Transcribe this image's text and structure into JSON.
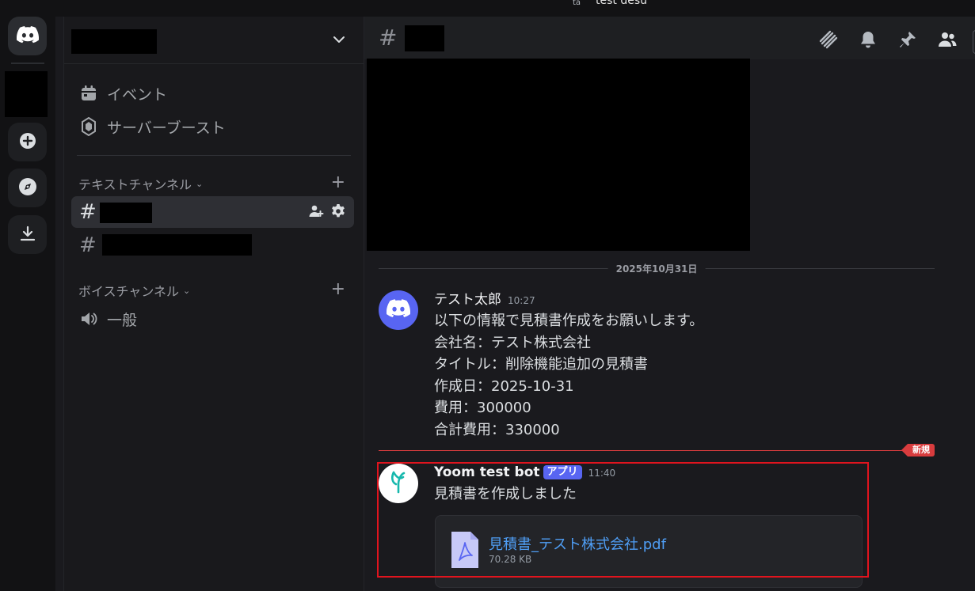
{
  "window": {
    "title": "test desu",
    "icon": "app-icon"
  },
  "rail": {
    "items": [
      {
        "name": "discord-home",
        "icon": "discord-logo-icon"
      },
      {
        "name": "redacted-server",
        "icon": ""
      },
      {
        "name": "add-server",
        "icon": "plus-circle-icon"
      },
      {
        "name": "explore-servers",
        "icon": "compass-icon"
      },
      {
        "name": "download-apps",
        "icon": "download-icon"
      }
    ]
  },
  "sidebar": {
    "server_name": "",
    "nav": [
      {
        "label": "イベント",
        "icon": "calendar-icon"
      },
      {
        "label": "サーバーブースト",
        "icon": "boost-gem-icon"
      }
    ],
    "text_category": "テキストチャンネル",
    "voice_category": "ボイスチャンネル",
    "text_channels": [
      {
        "hash": "#",
        "active": true
      },
      {
        "hash": "#",
        "active": false
      }
    ],
    "voice_channels": [
      {
        "label": "一般",
        "icon": "speaker-icon"
      }
    ]
  },
  "header": {
    "hash": "#",
    "icons": [
      "threads-icon",
      "bell-icon",
      "pin-icon",
      "members-icon"
    ]
  },
  "chat": {
    "date_divider": "2025年10月31日",
    "messages": [
      {
        "author": "テスト太郎",
        "time": "10:27",
        "avatar_icon": "discord-logo-icon",
        "lines": [
          "以下の情報で見積書作成をお願いします。",
          "会社名：テスト株式会社",
          "タイトル：削除機能追加の見積書",
          "作成日：2025-10-31",
          "費用：300000",
          "合計費用：330000"
        ]
      },
      {
        "author": "Yoom test bot",
        "badge": "アプリ",
        "time": "11:40",
        "avatar_icon": "yoom-logo-icon",
        "lines": [
          "見積書を作成しました"
        ],
        "attachment": {
          "filename": "見積書_テスト株式会社.pdf",
          "size": "70.28 KB",
          "icon": "pdf-file-icon"
        }
      }
    ],
    "new_label": "新規"
  },
  "colors": {
    "blurple": "#5865f2",
    "new_red": "#d83c3e",
    "link_blue": "#4f9ef5",
    "highlight_red": "#e0141e"
  }
}
